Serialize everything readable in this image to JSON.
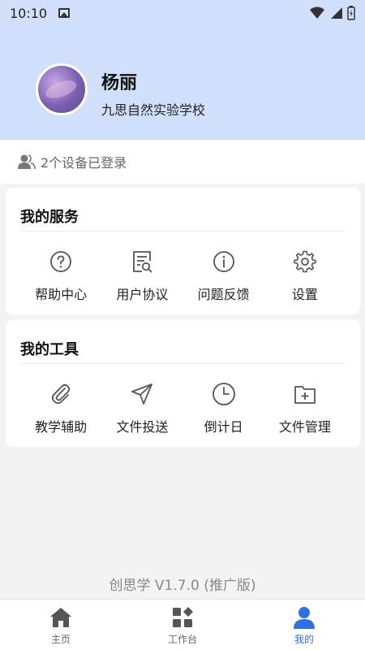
{
  "status_bar": {
    "time": "10:10"
  },
  "profile": {
    "name": "杨丽",
    "school": "九思自然实验学校"
  },
  "devices": {
    "text": "2个设备已登录"
  },
  "services": {
    "title": "我的服务",
    "items": [
      {
        "label": "帮助中心",
        "icon": "help-icon"
      },
      {
        "label": "用户协议",
        "icon": "document-search-icon"
      },
      {
        "label": "问题反馈",
        "icon": "info-icon"
      },
      {
        "label": "设置",
        "icon": "gear-icon"
      }
    ]
  },
  "tools": {
    "title": "我的工具",
    "items": [
      {
        "label": "教学辅助",
        "icon": "paperclip-icon"
      },
      {
        "label": "文件投送",
        "icon": "send-icon"
      },
      {
        "label": "倒计日",
        "icon": "clock-icon"
      },
      {
        "label": "文件管理",
        "icon": "folder-add-icon"
      }
    ]
  },
  "version": "创思学 V1.7.0 (推广版)",
  "tabbar": {
    "items": [
      {
        "label": "主页",
        "icon": "home-icon"
      },
      {
        "label": "工作台",
        "icon": "workbench-icon"
      },
      {
        "label": "我的",
        "icon": "person-icon"
      }
    ],
    "active_color": "#2f6fe0",
    "inactive_color": "#555555"
  },
  "colors": {
    "header_bg": "#d2dffa",
    "page_bg": "#f3f3f3"
  }
}
